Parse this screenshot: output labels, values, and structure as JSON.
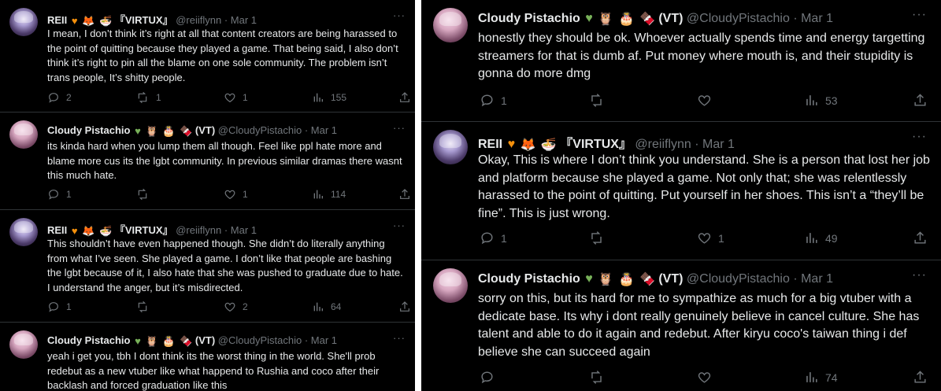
{
  "left_panel": {
    "tweets": [
      {
        "display_name": "REII",
        "emoji": [
          "orange-heart",
          "fox",
          "bowl"
        ],
        "tag": "『VIRTUX』",
        "handle": "@reiiflynn",
        "dot": "·",
        "date": "Mar 1",
        "more": "···",
        "text": "I mean, I don’t think it’s right at all that content creators are being harassed to the point of quitting because they played a game. That being said, I also don’t think it’s right to pin all the blame on one sole community. The problem isn’t trans people, It’s shitty people.",
        "replies": "2",
        "retweets": "1",
        "likes": "1",
        "views": "155"
      },
      {
        "display_name": "Cloudy Pistachio",
        "emoji": [
          "green-heart",
          "owl",
          "cake",
          "candy"
        ],
        "tag": "(VT)",
        "handle": "@CloudyPistachio",
        "dot": "·",
        "date": "Mar 1",
        "more": "···",
        "text": "its kinda hard when you lump them all though. Feel like ppl hate more and blame more cus its the lgbt community. In previous similar dramas there wasnt this much hate.",
        "replies": "1",
        "retweets": "",
        "likes": "1",
        "views": "114"
      },
      {
        "display_name": "REII",
        "emoji": [
          "orange-heart",
          "fox",
          "bowl"
        ],
        "tag": "『VIRTUX』",
        "handle": "@reiiflynn",
        "dot": "·",
        "date": "Mar 1",
        "more": "···",
        "text": "This shouldn’t have even happened though. She didn’t do literally anything from what I’ve seen. She played a game. I don’t like that people are bashing the lgbt because of it, I also hate that she was pushed to graduate due to hate. I understand the anger, but it’s misdirected.",
        "replies": "1",
        "retweets": "",
        "likes": "2",
        "views": "64"
      },
      {
        "display_name": "Cloudy Pistachio",
        "emoji": [
          "green-heart",
          "owl",
          "cake",
          "candy"
        ],
        "tag": "(VT)",
        "handle": "@CloudyPistachio",
        "dot": "·",
        "date": "Mar 1",
        "more": "···",
        "text": "yeah i get you, tbh I dont think its the worst thing in the world. She'll prob redebut as a new vtuber like what happend to Rushia and coco after their backlash and forced graduation like this",
        "replies": "",
        "retweets": "",
        "likes": "",
        "views": ""
      }
    ]
  },
  "right_panel": {
    "tweets": [
      {
        "display_name": "Cloudy Pistachio",
        "emoji": [
          "green-heart",
          "owl",
          "cake",
          "candy"
        ],
        "tag": "(VT)",
        "handle": "@CloudyPistachio",
        "dot": "·",
        "date": "Mar 1",
        "more": "···",
        "text": "honestly they should be ok. Whoever actually spends time and energy targetting streamers for that is dumb af. Put money where mouth is, and their stupidity is gonna do more dmg",
        "replies": "1",
        "retweets": "",
        "likes": "",
        "views": "53"
      },
      {
        "display_name": "REII",
        "emoji": [
          "orange-heart",
          "fox",
          "bowl"
        ],
        "tag": "『VIRTUX』",
        "handle": "@reiiflynn",
        "dot": "·",
        "date": "Mar 1",
        "more": "···",
        "text": "Okay, This is where I don’t think you understand. She is a person that lost her job and platform because she played a game. Not only that; she was relentlessly harassed to the point of quitting. Put yourself in her shoes. This isn’t a “they’ll be fine”. This is just wrong.",
        "replies": "1",
        "retweets": "",
        "likes": "1",
        "views": "49"
      },
      {
        "display_name": "Cloudy Pistachio",
        "emoji": [
          "green-heart",
          "owl",
          "cake",
          "candy"
        ],
        "tag": "(VT)",
        "handle": "@CloudyPistachio",
        "dot": "·",
        "date": "Mar 1",
        "more": "···",
        "text": "sorry on this, but its hard for me to sympathize as much for  a big vtuber with a dedicate base. Its why  i dont really genuinely believe in cancel culture. She has talent and able to do it again and redebut. After kiryu coco's taiwan thing i def believe she can succeed again",
        "replies": "",
        "retweets": "",
        "likes": "",
        "views": "74"
      }
    ]
  },
  "colors": {
    "background": "#000000",
    "divider": "#2f3336",
    "primary_text": "#e7e9ea",
    "secondary_text": "#71767b"
  }
}
